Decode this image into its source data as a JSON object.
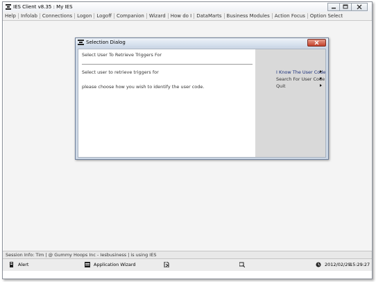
{
  "window": {
    "title": "IES Client v8.35 : My IES",
    "icon": "app-logo-icon"
  },
  "menubar": {
    "items": [
      "Help",
      "Infolab",
      "Connections",
      "Logon",
      "Logoff",
      "Companion",
      "Wizard",
      "How do I",
      "DataMarts",
      "Business Modules",
      "Action Focus",
      "Option Select"
    ]
  },
  "dialog": {
    "title": "Selection Dialog",
    "header_text": "Select User To Retrieve Triggers For",
    "line1": "Select user to retrieve triggers for",
    "line2": "please choose how you wish to identify the user code.",
    "options": [
      {
        "label": "I Know The User Code",
        "active": true
      },
      {
        "label": "Search For User Code",
        "active": false
      },
      {
        "label": "Quit",
        "active": false
      }
    ]
  },
  "status": {
    "text": "Session Info: Tim | @ Gummy Hoops Inc  - Iesbusiness | is using IES"
  },
  "taskbar": {
    "alert_label": "Alert",
    "wizard_label": "Application Wizard",
    "date": "2012/02/29",
    "time": "15:29:27"
  },
  "colors": {
    "active_option": "#1a2f7a",
    "close_button": "#c4412b",
    "dialog_right_panel": "#d9d9d9"
  }
}
